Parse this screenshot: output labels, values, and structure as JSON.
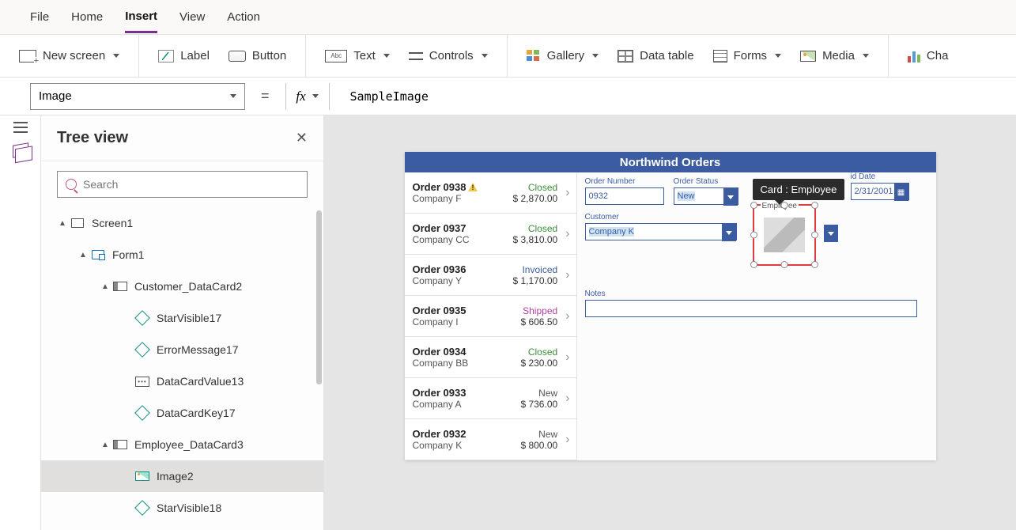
{
  "menu": {
    "file": "File",
    "home": "Home",
    "insert": "Insert",
    "view": "View",
    "action": "Action",
    "active": "insert"
  },
  "ribbon": {
    "new_screen": "New screen",
    "label": "Label",
    "button": "Button",
    "text": "Text",
    "controls": "Controls",
    "gallery": "Gallery",
    "data_table": "Data table",
    "forms": "Forms",
    "media": "Media",
    "charts": "Cha",
    "text_icon_label": "Abc"
  },
  "formula": {
    "property": "Image",
    "fx": "fx",
    "equals": "=",
    "value": "SampleImage"
  },
  "tree": {
    "title": "Tree view",
    "search_placeholder": "Search",
    "nodes": {
      "screen1": "Screen1",
      "form1": "Form1",
      "customer_card": "Customer_DataCard2",
      "starvisible17": "StarVisible17",
      "errormessage17": "ErrorMessage17",
      "datacardvalue13": "DataCardValue13",
      "datacardkey17": "DataCardKey17",
      "employee_card": "Employee_DataCard3",
      "image2": "Image2",
      "starvisible18": "StarVisible18"
    }
  },
  "app": {
    "title": "Northwind Orders",
    "orders": [
      {
        "num": "Order 0938",
        "company": "Company F",
        "status": "Closed",
        "amount": "$ 2,870.00",
        "warn": true
      },
      {
        "num": "Order 0937",
        "company": "Company CC",
        "status": "Closed",
        "amount": "$ 3,810.00",
        "warn": false
      },
      {
        "num": "Order 0936",
        "company": "Company Y",
        "status": "Invoiced",
        "amount": "$ 1,170.00",
        "warn": false
      },
      {
        "num": "Order 0935",
        "company": "Company I",
        "status": "Shipped",
        "amount": "$ 606.50",
        "warn": false
      },
      {
        "num": "Order 0934",
        "company": "Company BB",
        "status": "Closed",
        "amount": "$ 230.00",
        "warn": false
      },
      {
        "num": "Order 0933",
        "company": "Company A",
        "status": "New",
        "amount": "$ 736.00",
        "warn": false
      },
      {
        "num": "Order 0932",
        "company": "Company K",
        "status": "New",
        "amount": "$ 800.00",
        "warn": false
      }
    ],
    "form": {
      "order_number_label": "Order Number",
      "order_number": "0932",
      "order_status_label": "Order Status",
      "order_status": "New",
      "customer_label": "Customer",
      "customer": "Company K",
      "employee_label": "Employee",
      "paid_date_label": "id Date",
      "paid_date": "2/31/2001",
      "notes_label": "Notes",
      "notes": ""
    },
    "tooltip": "Card : Employee"
  }
}
